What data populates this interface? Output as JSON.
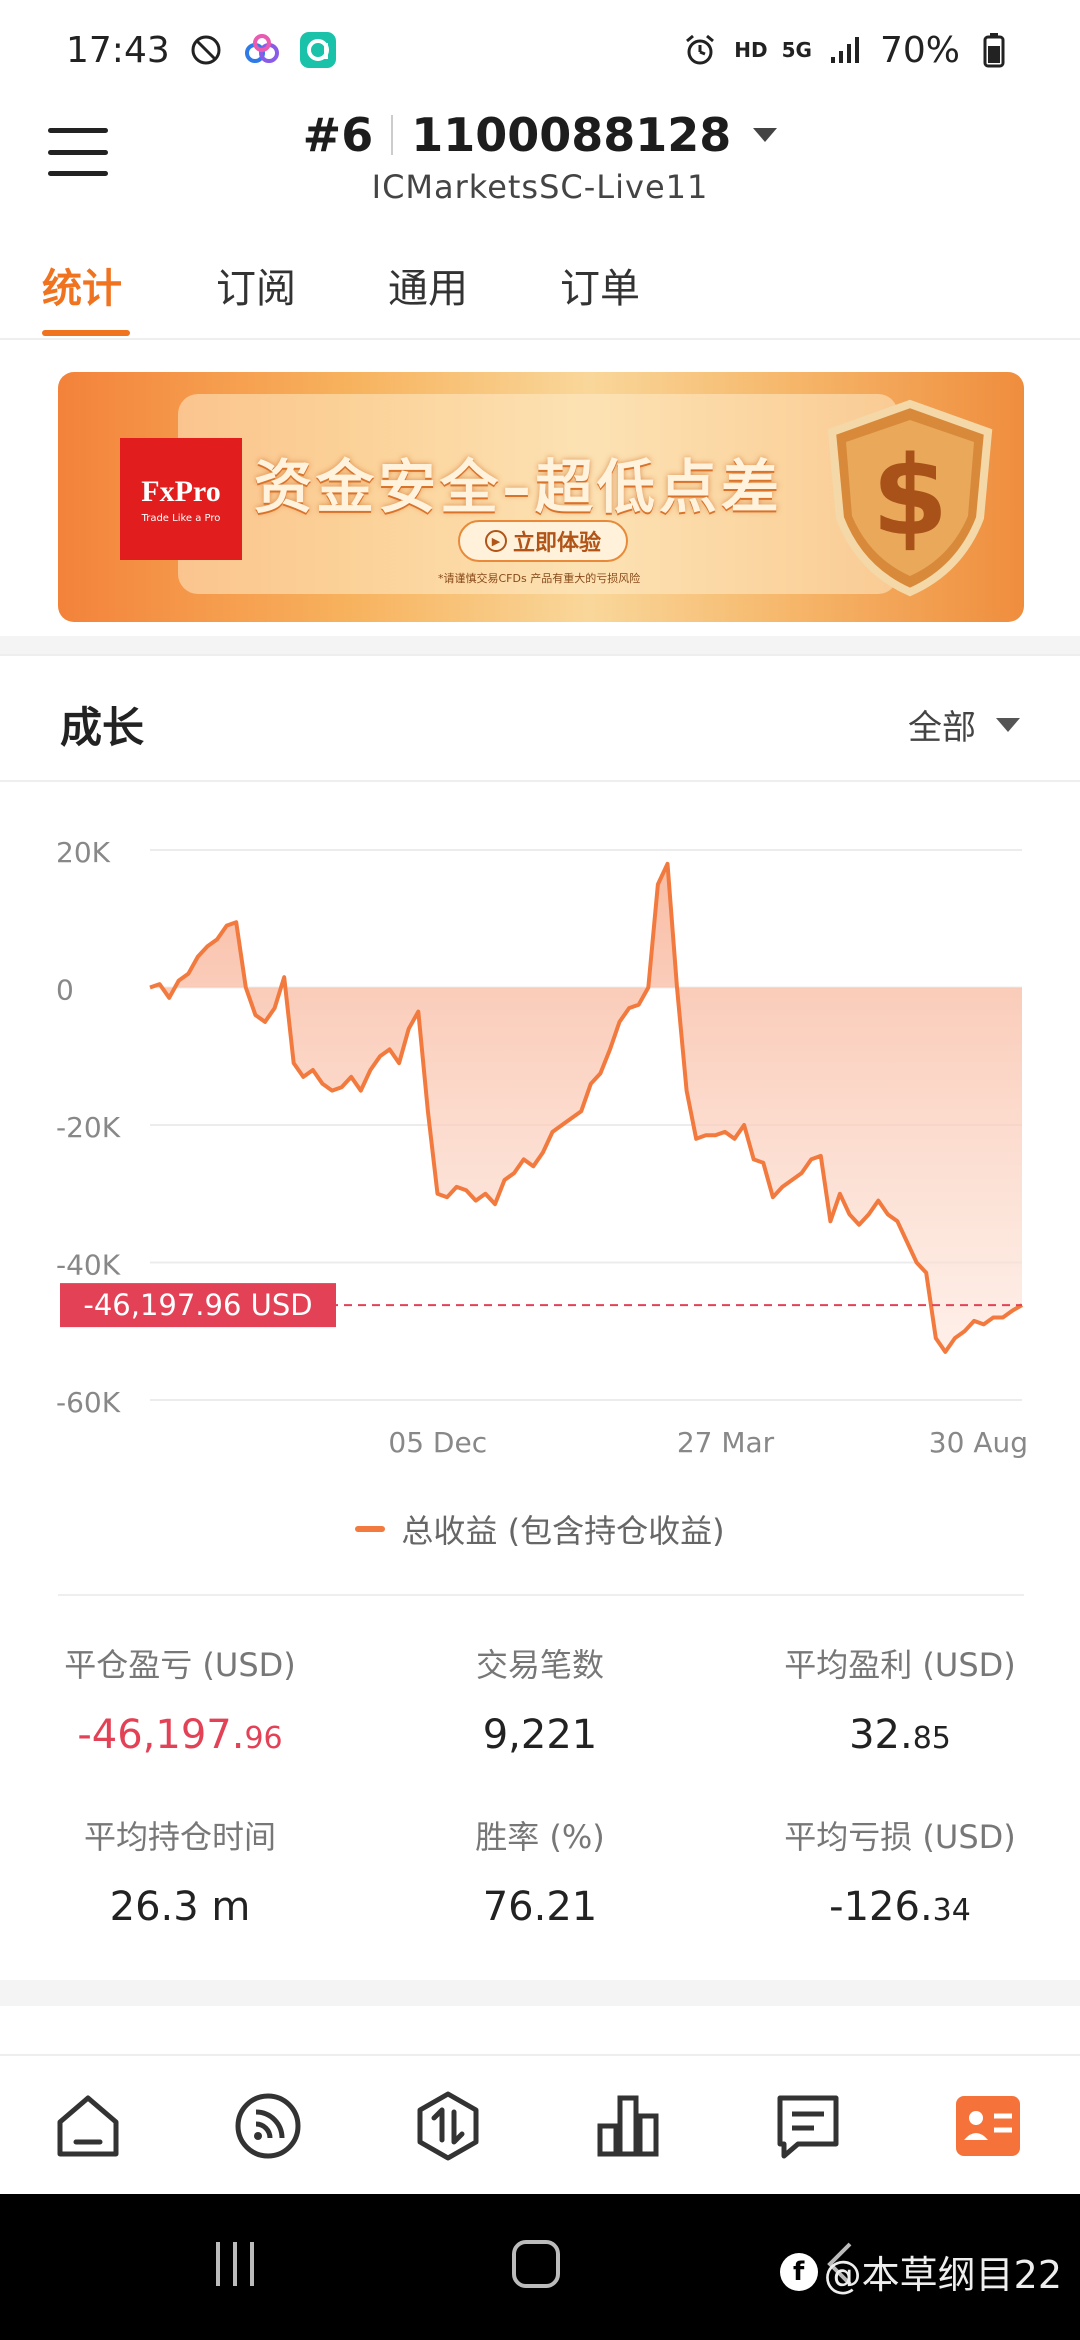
{
  "status_bar": {
    "time": "17:43",
    "network": "HD",
    "signal_type": "5G",
    "battery": "70%"
  },
  "header": {
    "account_index": "#6",
    "account_number": "1100088128",
    "server": "ICMarketsSC-Live11"
  },
  "tabs": [
    {
      "label": "统计",
      "active": true
    },
    {
      "label": "订阅",
      "active": false
    },
    {
      "label": "通用",
      "active": false
    },
    {
      "label": "订单",
      "active": false
    }
  ],
  "banner": {
    "brand": "FxPro",
    "brand_tagline": "Trade Like a Pro",
    "headline": "资金安全–超低点差",
    "cta": "立即体验",
    "disclaimer": "*请谨慎交易CFDs 产品有重大的亏损风险",
    "accent_color": "#f0731f"
  },
  "growth_section": {
    "title": "成长",
    "range_selected": "全部"
  },
  "chart_data": {
    "type": "area",
    "title": "",
    "xlabel": "",
    "ylabel": "",
    "ylim": [
      -60000,
      20000
    ],
    "y_ticks": [
      "20K",
      "0",
      "-20K",
      "-40K",
      "-60K"
    ],
    "x_ticks": [
      "05 Dec",
      "27 Mar",
      "30 Aug"
    ],
    "current_value_label": "-46,197.96 USD",
    "current_value": -46197.96,
    "grid": true,
    "legend_position": "bottom",
    "series": [
      {
        "name": "总收益 (包含持仓收益)",
        "color": "#f27a3e",
        "values": [
          0,
          500,
          -1500,
          1000,
          2000,
          4500,
          6000,
          7000,
          9000,
          9500,
          0,
          -4000,
          -5000,
          -3000,
          1500,
          -11000,
          -13000,
          -12000,
          -14000,
          -15000,
          -14500,
          -13000,
          -15000,
          -12000,
          -10000,
          -9000,
          -11000,
          -6000,
          -3500,
          -18000,
          -30000,
          -30500,
          -29000,
          -29500,
          -31000,
          -30000,
          -31500,
          -28000,
          -27000,
          -25000,
          -26000,
          -24000,
          -21000,
          -20000,
          -19000,
          -18000,
          -14000,
          -12500,
          -9000,
          -5000,
          -3000,
          -2500,
          0,
          15000,
          18000,
          0,
          -15000,
          -22000,
          -21500,
          -21500,
          -21000,
          -22000,
          -20000,
          -25000,
          -25500,
          -30500,
          -29000,
          -28000,
          -27000,
          -25000,
          -24500,
          -34000,
          -30000,
          -33000,
          -34500,
          -33000,
          -31000,
          -33000,
          -34000,
          -37000,
          -40000,
          -41500,
          -51000,
          -53000,
          -51000,
          -50000,
          -48500,
          -49000,
          -48000,
          -48000,
          -47000,
          -46197.96
        ]
      }
    ]
  },
  "stats": [
    {
      "label": "平仓盈亏 (USD)",
      "int": "-46,197.",
      "dec": "96",
      "negative": true
    },
    {
      "label": "交易笔数",
      "int": "9,221",
      "dec": "",
      "negative": false
    },
    {
      "label": "平均盈利 (USD)",
      "int": "32.",
      "dec": "85",
      "negative": false
    },
    {
      "label": "平均持仓时间",
      "int": "26.3 m",
      "dec": "",
      "negative": false
    },
    {
      "label": "胜率 (%)",
      "int": "76.21",
      "dec": "",
      "negative": false
    },
    {
      "label": "平均亏损 (USD)",
      "int": "-126.",
      "dec": "34",
      "negative": false
    }
  ],
  "bottom_nav": [
    {
      "name": "home-icon"
    },
    {
      "name": "feed-icon"
    },
    {
      "name": "trade-icon"
    },
    {
      "name": "chart-icon"
    },
    {
      "name": "messages-icon"
    },
    {
      "name": "profile-icon",
      "active": true
    }
  ],
  "watermark": "@本草纲目22"
}
